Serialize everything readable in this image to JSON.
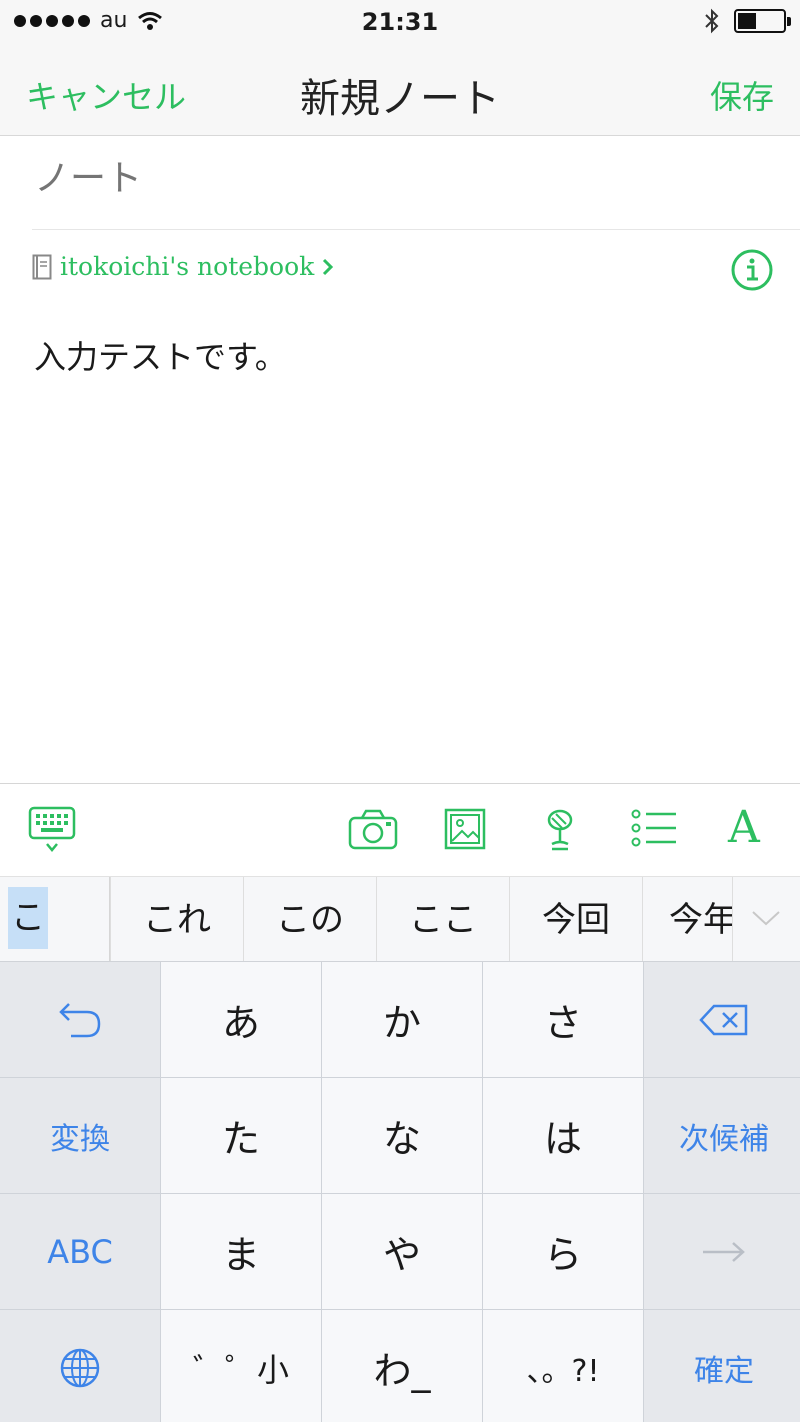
{
  "status_bar": {
    "carrier": "au",
    "time": "21:31"
  },
  "nav": {
    "cancel_label": "キャンセル",
    "title": "新規ノート",
    "save_label": "保存"
  },
  "editor": {
    "title_placeholder": "ノート",
    "notebook_name": "itokoichi's notebook",
    "body_text": "入力テストです。"
  },
  "toolbar": {
    "icons": [
      "keyboard-dismiss-icon",
      "camera-icon",
      "image-icon",
      "sketch-icon",
      "list-icon",
      "format-icon"
    ],
    "format_label": "A"
  },
  "candidates": {
    "current": "こ",
    "items": [
      "これ",
      "この",
      "ここ",
      "今回",
      "今年"
    ]
  },
  "keyboard": {
    "row1": [
      "あ",
      "か",
      "さ"
    ],
    "row2": [
      "た",
      "な",
      "は"
    ],
    "row3": [
      "ま",
      "や",
      "ら"
    ],
    "row4": [
      "゛゜小",
      "わ_",
      "、。?!"
    ],
    "convert_label": "変換",
    "next_candidate_label": "次候補",
    "abc_label": "ABC",
    "confirm_label": "確定",
    "accent_color": "#3e84e8"
  },
  "colors": {
    "brand_green": "#2dbe60"
  }
}
